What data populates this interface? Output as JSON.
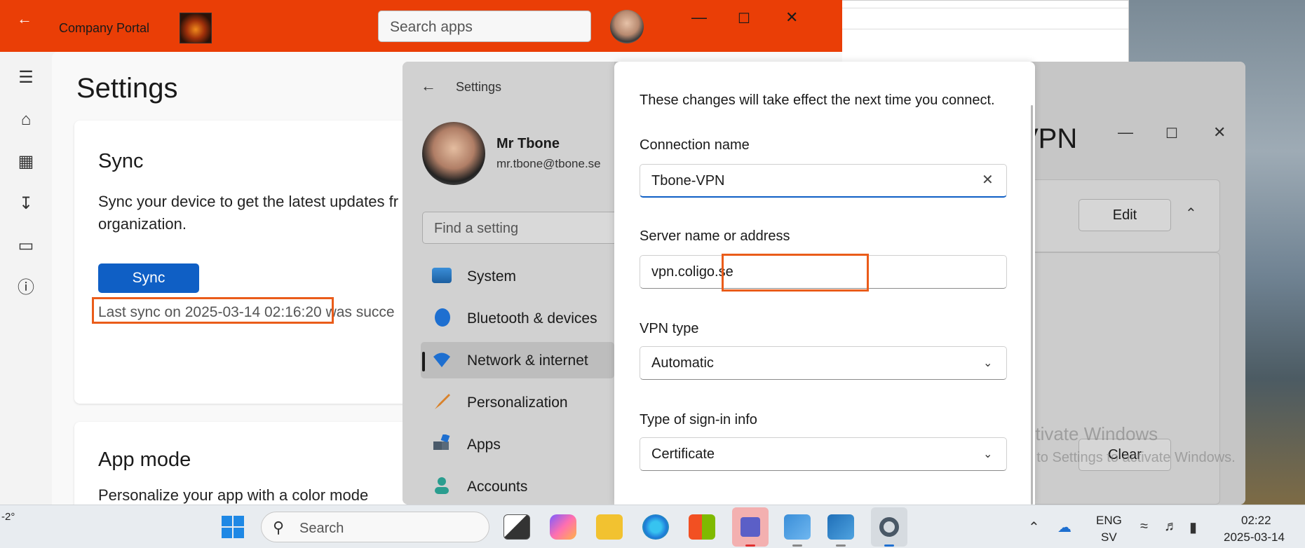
{
  "company_portal": {
    "title": "Company Portal",
    "search_placeholder": "Search apps",
    "heading": "Settings",
    "sync": {
      "title": "Sync",
      "description": "Sync your device to get the latest updates fr… organization.",
      "description_line1": "Sync your device to get the latest updates fr",
      "description_line2": "organization.",
      "button_label": "Sync",
      "status": "Last sync on 2025-03-14 02:16:20 was succe"
    },
    "app_mode": {
      "title": "App mode",
      "description": "Personalize your app with a color mode"
    },
    "nav_icons": [
      "menu-icon",
      "home-icon",
      "apps-icon",
      "download-icon",
      "device-icon",
      "help-icon"
    ]
  },
  "settings": {
    "title": "Settings",
    "user_name": "Mr Tbone",
    "user_email": "mr.tbone@tbone.se",
    "find_placeholder": "Find a setting",
    "nav": [
      {
        "label": "System"
      },
      {
        "label": "Bluetooth & devices"
      },
      {
        "label": "Network & internet"
      },
      {
        "label": "Personalization"
      },
      {
        "label": "Apps"
      },
      {
        "label": "Accounts"
      }
    ],
    "vpn_title_partial": "VPN",
    "edit_label": "Edit",
    "clear_label": "Clear",
    "watermark_line1": "Activate Windows",
    "watermark_line2": "Go to Settings to activate Windows."
  },
  "vpn_dialog": {
    "note": "These changes will take effect the next time you connect.",
    "connection_name_label": "Connection name",
    "connection_name_value": "Tbone-VPN",
    "server_label": "Server name or address",
    "server_value": "vpn.coligo.se",
    "vpn_type_label": "VPN type",
    "vpn_type_value": "Automatic",
    "signin_label": "Type of sign-in info",
    "signin_value": "Certificate"
  },
  "taskbar": {
    "weather": "-2°",
    "search_label": "Search",
    "lang_line1": "ENG",
    "lang_line2": "SV",
    "time": "02:22",
    "date": "2025-03-14"
  },
  "colors": {
    "portal_accent": "#ea3e06",
    "sync_button": "#0f5fc5",
    "highlight_box": "#ea5c1a"
  }
}
